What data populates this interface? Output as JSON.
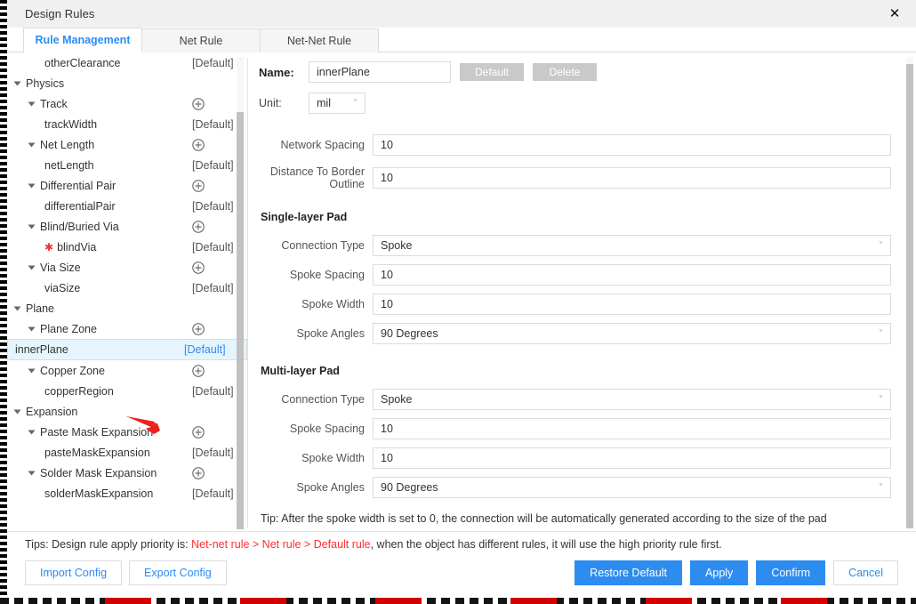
{
  "window": {
    "title": "Design Rules",
    "close_icon": "close-icon"
  },
  "tabs": [
    {
      "label": "Rule Management",
      "active": true
    },
    {
      "label": "Net Rule",
      "active": false
    },
    {
      "label": "Net-Net Rule",
      "active": false
    }
  ],
  "tree": {
    "default_badge": "[Default]",
    "add_icon": "plus-circle-icon",
    "items": [
      {
        "label": "otherClearance",
        "right": "[Default]",
        "type": "leaf",
        "indent": 2,
        "selected": false,
        "star": false
      },
      {
        "label": "Physics",
        "right": "",
        "type": "group",
        "indent": 0,
        "selected": false,
        "star": false
      },
      {
        "label": "Track",
        "right": "add",
        "type": "group",
        "indent": 1,
        "selected": false,
        "star": false
      },
      {
        "label": "trackWidth",
        "right": "[Default]",
        "type": "leaf",
        "indent": 2,
        "selected": false,
        "star": false
      },
      {
        "label": "Net Length",
        "right": "add",
        "type": "group",
        "indent": 1,
        "selected": false,
        "star": false
      },
      {
        "label": "netLength",
        "right": "[Default]",
        "type": "leaf",
        "indent": 2,
        "selected": false,
        "star": false
      },
      {
        "label": "Differential Pair",
        "right": "add",
        "type": "group",
        "indent": 1,
        "selected": false,
        "star": false
      },
      {
        "label": "differentialPair",
        "right": "[Default]",
        "type": "leaf",
        "indent": 2,
        "selected": false,
        "star": false
      },
      {
        "label": "Blind/Buried Via",
        "right": "add",
        "type": "group",
        "indent": 1,
        "selected": false,
        "star": false
      },
      {
        "label": "blindVia",
        "right": "[Default]",
        "type": "leaf",
        "indent": 2,
        "selected": false,
        "star": true
      },
      {
        "label": "Via Size",
        "right": "add",
        "type": "group",
        "indent": 1,
        "selected": false,
        "star": false
      },
      {
        "label": "viaSize",
        "right": "[Default]",
        "type": "leaf",
        "indent": 2,
        "selected": false,
        "star": false
      },
      {
        "label": "Plane",
        "right": "",
        "type": "group",
        "indent": 0,
        "selected": false,
        "star": false
      },
      {
        "label": "Plane Zone",
        "right": "add",
        "type": "group",
        "indent": 1,
        "selected": false,
        "star": false
      },
      {
        "label": "innerPlane",
        "right": "[Default]",
        "type": "leaf",
        "indent": 2,
        "selected": true,
        "star": false
      },
      {
        "label": "Copper Zone",
        "right": "add",
        "type": "group",
        "indent": 1,
        "selected": false,
        "star": false
      },
      {
        "label": "copperRegion",
        "right": "[Default]",
        "type": "leaf",
        "indent": 2,
        "selected": false,
        "star": false
      },
      {
        "label": "Expansion",
        "right": "",
        "type": "group",
        "indent": 0,
        "selected": false,
        "star": false
      },
      {
        "label": "Paste Mask Expansion",
        "right": "add",
        "type": "group",
        "indent": 1,
        "selected": false,
        "star": false
      },
      {
        "label": "pasteMaskExpansion",
        "right": "[Default]",
        "type": "leaf",
        "indent": 2,
        "selected": false,
        "star": false
      },
      {
        "label": "Solder Mask Expansion",
        "right": "add",
        "type": "group",
        "indent": 1,
        "selected": false,
        "star": false
      },
      {
        "label": "solderMaskExpansion",
        "right": "[Default]",
        "type": "leaf",
        "indent": 2,
        "selected": false,
        "star": false
      }
    ]
  },
  "form": {
    "name_label": "Name:",
    "name_value": "innerPlane",
    "default_button": "Default",
    "delete_button": "Delete",
    "unit_label": "Unit:",
    "unit_value": "mil",
    "network_spacing_label": "Network Spacing",
    "network_spacing_value": "10",
    "distance_border_label": "Distance To Border Outline",
    "distance_border_value": "10",
    "single_layer": {
      "title": "Single-layer Pad",
      "connection_type_label": "Connection Type",
      "connection_type_value": "Spoke",
      "spoke_spacing_label": "Spoke Spacing",
      "spoke_spacing_value": "10",
      "spoke_width_label": "Spoke Width",
      "spoke_width_value": "10",
      "spoke_angles_label": "Spoke Angles",
      "spoke_angles_value": "90 Degrees"
    },
    "multi_layer": {
      "title": "Multi-layer Pad",
      "connection_type_label": "Connection Type",
      "connection_type_value": "Spoke",
      "spoke_spacing_label": "Spoke Spacing",
      "spoke_spacing_value": "10",
      "spoke_width_label": "Spoke Width",
      "spoke_width_value": "10",
      "spoke_angles_label": "Spoke Angles",
      "spoke_angles_value": "90 Degrees"
    },
    "tip": "Tip: After the spoke width is set to 0, the connection will be automatically generated according to the size of the pad"
  },
  "footer": {
    "tips_prefix": "Tips: Design rule apply priority is: ",
    "tips_priority": "Net-net rule > Net rule > Default rule",
    "tips_suffix": ", when the object has different rules, it will use the high priority rule first.",
    "import_config": "Import Config",
    "export_config": "Export Config",
    "restore_default": "Restore Default",
    "apply": "Apply",
    "confirm": "Confirm",
    "cancel": "Cancel"
  },
  "colors": {
    "accent_blue": "#2d8cf0",
    "selection_bg": "#e6f4fd",
    "tip_red": "#ff2d2d",
    "pointer_red": "#ee2222",
    "disabled_grey": "#c9c9c9"
  },
  "annotations": {
    "pointer_arrow": "red-arrow-pointer"
  }
}
